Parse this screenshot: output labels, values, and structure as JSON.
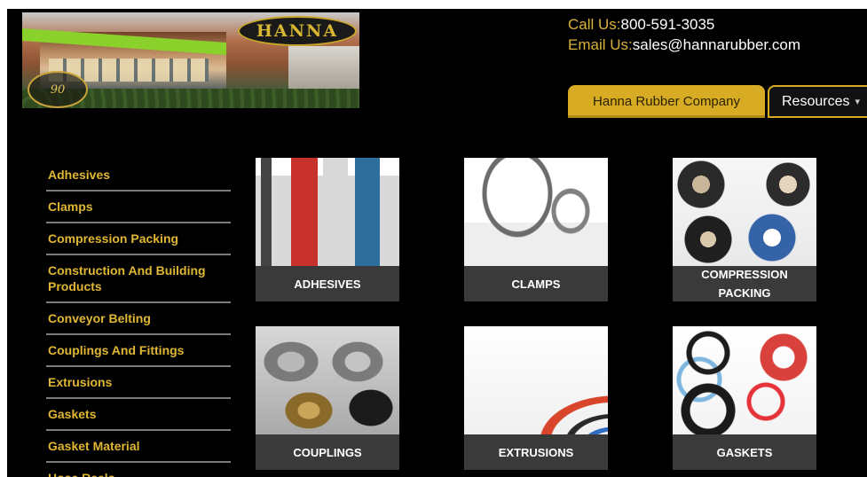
{
  "header": {
    "logo": {
      "brand_text": "HANNA",
      "seal_text": "90"
    },
    "contact": {
      "phone_label": "Call Us:",
      "phone_value": "800-591-3035",
      "email_label": "Email Us:",
      "email_value": "sales@hannarubber.com"
    },
    "nav": {
      "primary_label": "Hanna Rubber Company",
      "secondary_label": "Resources"
    }
  },
  "sidebar": {
    "items": [
      {
        "label": "Adhesives"
      },
      {
        "label": "Clamps"
      },
      {
        "label": "Compression Packing"
      },
      {
        "label": "Construction And Building Products"
      },
      {
        "label": "Conveyor Belting"
      },
      {
        "label": "Couplings And Fittings"
      },
      {
        "label": "Extrusions"
      },
      {
        "label": "Gaskets"
      },
      {
        "label": "Gasket Material"
      },
      {
        "label": "Hose Reels"
      }
    ]
  },
  "products": [
    {
      "caption": "ADHESIVES"
    },
    {
      "caption": "CLAMPS"
    },
    {
      "caption": "COMPRESSION PACKING"
    },
    {
      "caption": "COUPLINGS"
    },
    {
      "caption": "EXTRUSIONS"
    },
    {
      "caption": "GASKETS"
    }
  ],
  "colors": {
    "background": "#000000",
    "accent_gold": "#d7ac24",
    "caption_bar": "#3a3a3a"
  }
}
